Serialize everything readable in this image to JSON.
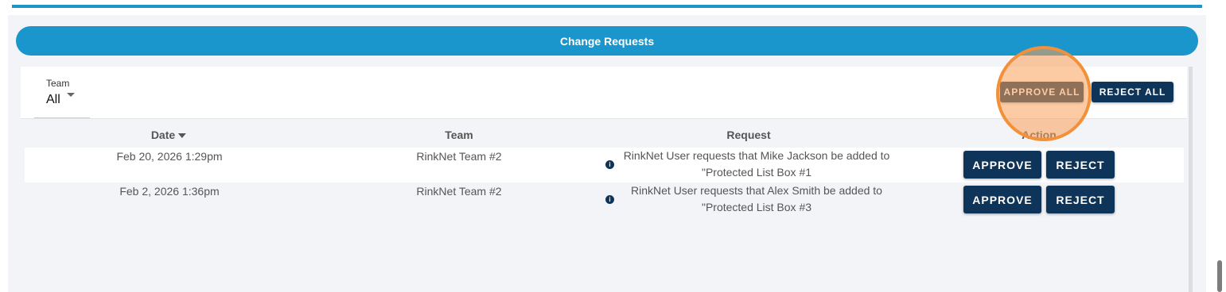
{
  "header": {
    "title": "Change Requests"
  },
  "filter": {
    "team_label": "Team",
    "team_value": "All"
  },
  "bulk_actions": {
    "approve_all": "APPROVE ALL",
    "reject_all": "REJECT ALL"
  },
  "table": {
    "columns": {
      "date": "Date",
      "team": "Team",
      "request": "Request",
      "action": "Action"
    },
    "rows": [
      {
        "date": "Feb 20, 2026 1:29pm",
        "team": "RinkNet Team #2",
        "request_line1": "RinkNet User requests that Mike Jackson be added to",
        "request_line2": "\"Protected List Box #1",
        "approve": "APPROVE",
        "reject": "REJECT"
      },
      {
        "date": "Feb 2, 2026 1:36pm",
        "team": "RinkNet Team #2",
        "request_line1": "RinkNet User requests that Alex Smith be added to",
        "request_line2": "\"Protected List Box #3",
        "approve": "APPROVE",
        "reject": "REJECT"
      }
    ]
  },
  "colors": {
    "header_blue": "#1a96cc",
    "button_navy": "#0e3559",
    "highlight_orange": "#f2913a"
  },
  "icons": {
    "info": "info-icon",
    "dropdown": "caret-down-icon",
    "sort": "sort-desc-icon"
  }
}
